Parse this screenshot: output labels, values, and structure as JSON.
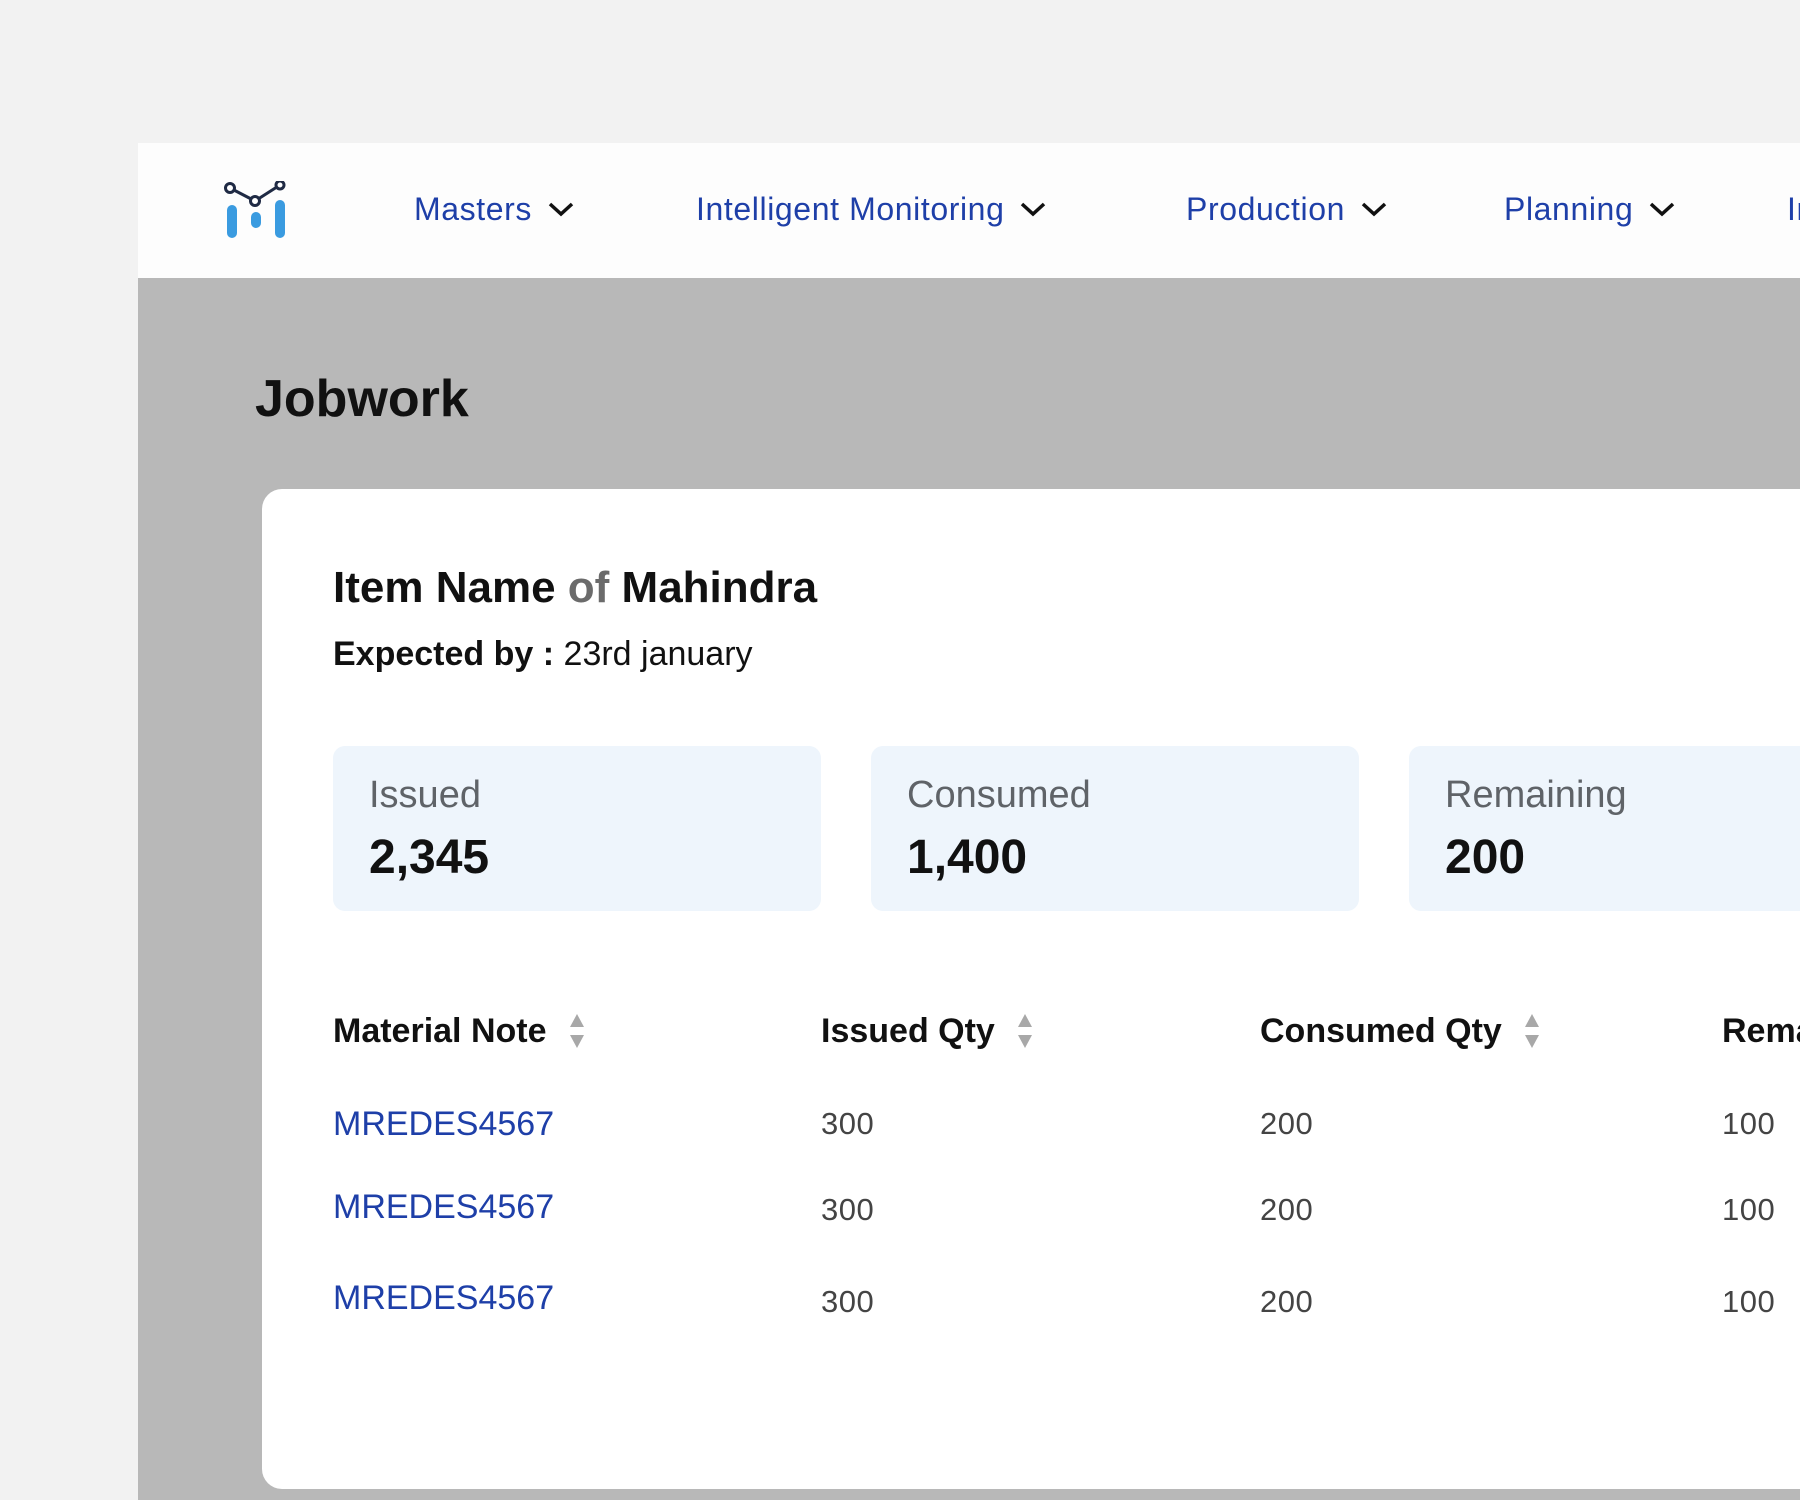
{
  "nav": {
    "items": [
      {
        "label": "Masters"
      },
      {
        "label": "Intelligent Monitoring"
      },
      {
        "label": "Production"
      },
      {
        "label": "Planning"
      },
      {
        "label": "Inve"
      }
    ]
  },
  "page": {
    "title": "Jobwork"
  },
  "item": {
    "name": "Item Name",
    "of": "of",
    "company": "Mahindra",
    "expected_label": "Expected by :",
    "expected_value": "23rd january"
  },
  "stats": [
    {
      "label": "Issued",
      "value": "2,345"
    },
    {
      "label": "Consumed",
      "value": "1,400"
    },
    {
      "label": "Remaining",
      "value": "200"
    }
  ],
  "table": {
    "headers": [
      "Material Note",
      "Issued Qty",
      "Consumed Qty",
      "Rema"
    ],
    "rows": [
      [
        "MREDES4567",
        "300",
        "200",
        "100"
      ],
      [
        "MREDES4567",
        "300",
        "200",
        "100"
      ],
      [
        "MREDES4567",
        "300",
        "200",
        "100"
      ]
    ]
  },
  "colors": {
    "link": "#1e3fa8",
    "logo_blue": "#3a9be0",
    "logo_dark": "#1f2a44",
    "stat_bg": "#eef5fc",
    "backdrop": "#b8b8b8"
  }
}
